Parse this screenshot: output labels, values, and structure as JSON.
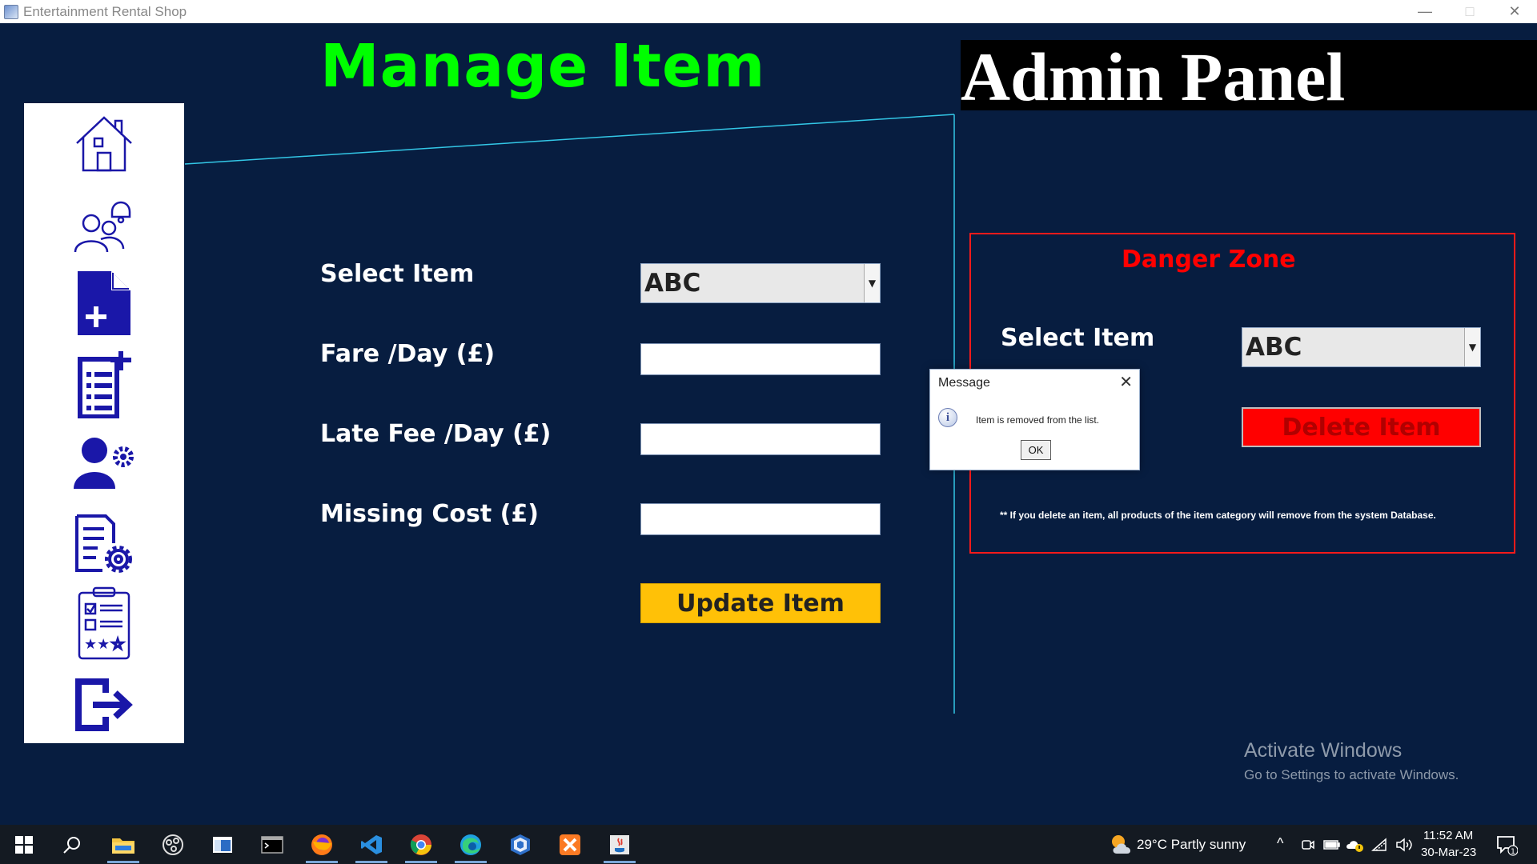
{
  "window": {
    "title": "Entertainment Rental Shop",
    "controls": [
      "—",
      "□",
      "✕"
    ]
  },
  "header": {
    "title": "Manage Item",
    "admin_title": "Admin Panel"
  },
  "sidebar": {
    "items": [
      {
        "name": "home-icon"
      },
      {
        "name": "users-notification-icon"
      },
      {
        "name": "add-file-icon"
      },
      {
        "name": "add-list-icon"
      },
      {
        "name": "user-settings-icon"
      },
      {
        "name": "document-settings-icon"
      },
      {
        "name": "checklist-rating-icon"
      },
      {
        "name": "logout-icon"
      }
    ]
  },
  "form": {
    "select_label": "Select Item",
    "select_value": "ABC",
    "fare_label": "Fare /Day (£)",
    "fare_value": "",
    "late_fee_label": "Late Fee /Day (£)",
    "late_fee_value": "",
    "missing_cost_label": "Missing Cost (£)",
    "missing_cost_value": "",
    "update_label": "Update Item"
  },
  "danger": {
    "title": "Danger Zone",
    "select_label": "Select Item",
    "select_value": "ABC",
    "delete_label": "Delete Item",
    "note": "** If you delete an item, all products of the item category will remove from the system Database."
  },
  "dialog": {
    "title": "Message",
    "message": "Item is removed from the list.",
    "ok_label": "OK"
  },
  "watermark": {
    "line1": "Activate Windows",
    "line2": "Go to Settings to activate Windows."
  },
  "taskbar": {
    "apps": [
      "start-icon",
      "search-icon",
      "file-explorer-icon",
      "obs-icon",
      "window-app-icon",
      "terminal-icon",
      "firefox-icon",
      "vscode-icon",
      "chrome-icon",
      "edge-icon",
      "virtualbox-icon",
      "xampp-icon",
      "java-icon"
    ],
    "weather": "29°C  Partly sunny",
    "time": "11:52 AM",
    "date": "30-Mar-23",
    "notification_count": "1"
  },
  "colors": {
    "background": "#071d40",
    "heading_green": "#00ff00",
    "update_yellow": "#ffc107",
    "danger_red": "#ff0000",
    "icon_blue": "#1a17a8",
    "divider_cyan": "#33c7e6"
  }
}
